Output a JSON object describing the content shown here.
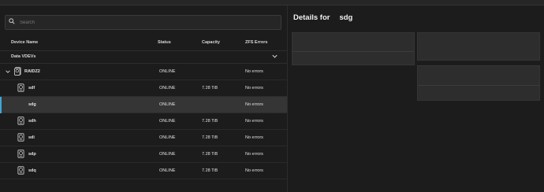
{
  "search": {
    "placeholder": "Search",
    "value": ""
  },
  "table": {
    "columns": {
      "device": "Device Name",
      "status": "Status",
      "capacity": "Capacity",
      "errors": "ZFS Errors"
    },
    "group": "Data VDEVs",
    "vdev": {
      "name": "RAIDZ2",
      "status": "ONLINE",
      "capacity": "",
      "errors": "No errors"
    },
    "disks": [
      {
        "name": "sdf",
        "status": "ONLINE",
        "capacity": "7.28 TiB",
        "errors": "No errors"
      },
      {
        "name": "sdg",
        "status": "ONLINE",
        "capacity": "",
        "errors": "No errors",
        "selected": true
      },
      {
        "name": "sdh",
        "status": "ONLINE",
        "capacity": "7.28 TiB",
        "errors": "No errors"
      },
      {
        "name": "sdi",
        "status": "ONLINE",
        "capacity": "7.28 TiB",
        "errors": "No errors"
      },
      {
        "name": "sdp",
        "status": "ONLINE",
        "capacity": "7.28 TiB",
        "errors": "No errors"
      },
      {
        "name": "sdq",
        "status": "ONLINE",
        "capacity": "7.28 TiB",
        "errors": "No errors"
      }
    ]
  },
  "details": {
    "title": "Details for",
    "device": "sdg"
  },
  "colors": {
    "accent": "#3ea7d8",
    "selected_row": "#353535",
    "background": "#1c1c1c",
    "card": "#2d2d2d"
  },
  "icons": {
    "search": "search-icon",
    "expand": "chevron-down-icon",
    "collapse": "chevron-down-icon",
    "disk": "hard-disk-icon",
    "vdev": "disk-stack-icon"
  }
}
